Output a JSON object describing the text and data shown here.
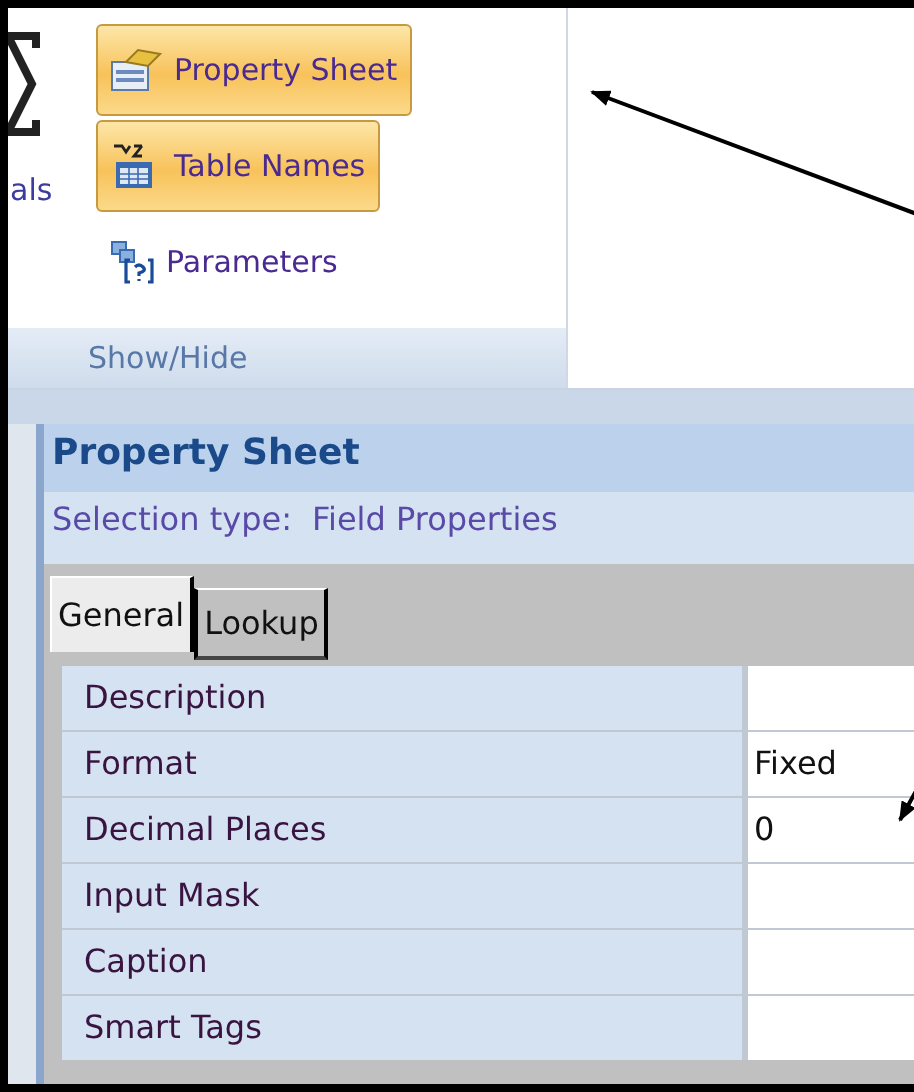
{
  "ribbon": {
    "cut_label": "als",
    "buttons": [
      {
        "label": "Property Sheet",
        "selected": true,
        "kind": "sheet"
      },
      {
        "label": "Table Names",
        "selected": true,
        "kind": "table"
      },
      {
        "label": "Parameters",
        "selected": false,
        "kind": "params"
      }
    ],
    "group_label": "Show/Hide"
  },
  "property_sheet": {
    "title": "Property Sheet",
    "selection_label": "Selection type:",
    "selection_value": "Field Properties",
    "tabs": [
      {
        "label": "General",
        "selected": true
      },
      {
        "label": "Lookup",
        "selected": false
      }
    ],
    "rows": [
      {
        "name": "Description"
      },
      {
        "name": "Format",
        "value": "Fixed"
      },
      {
        "name": "Decimal Places",
        "value": "0"
      },
      {
        "name": "Input Mask"
      },
      {
        "name": "Caption"
      },
      {
        "name": "Smart Tags"
      }
    ]
  }
}
